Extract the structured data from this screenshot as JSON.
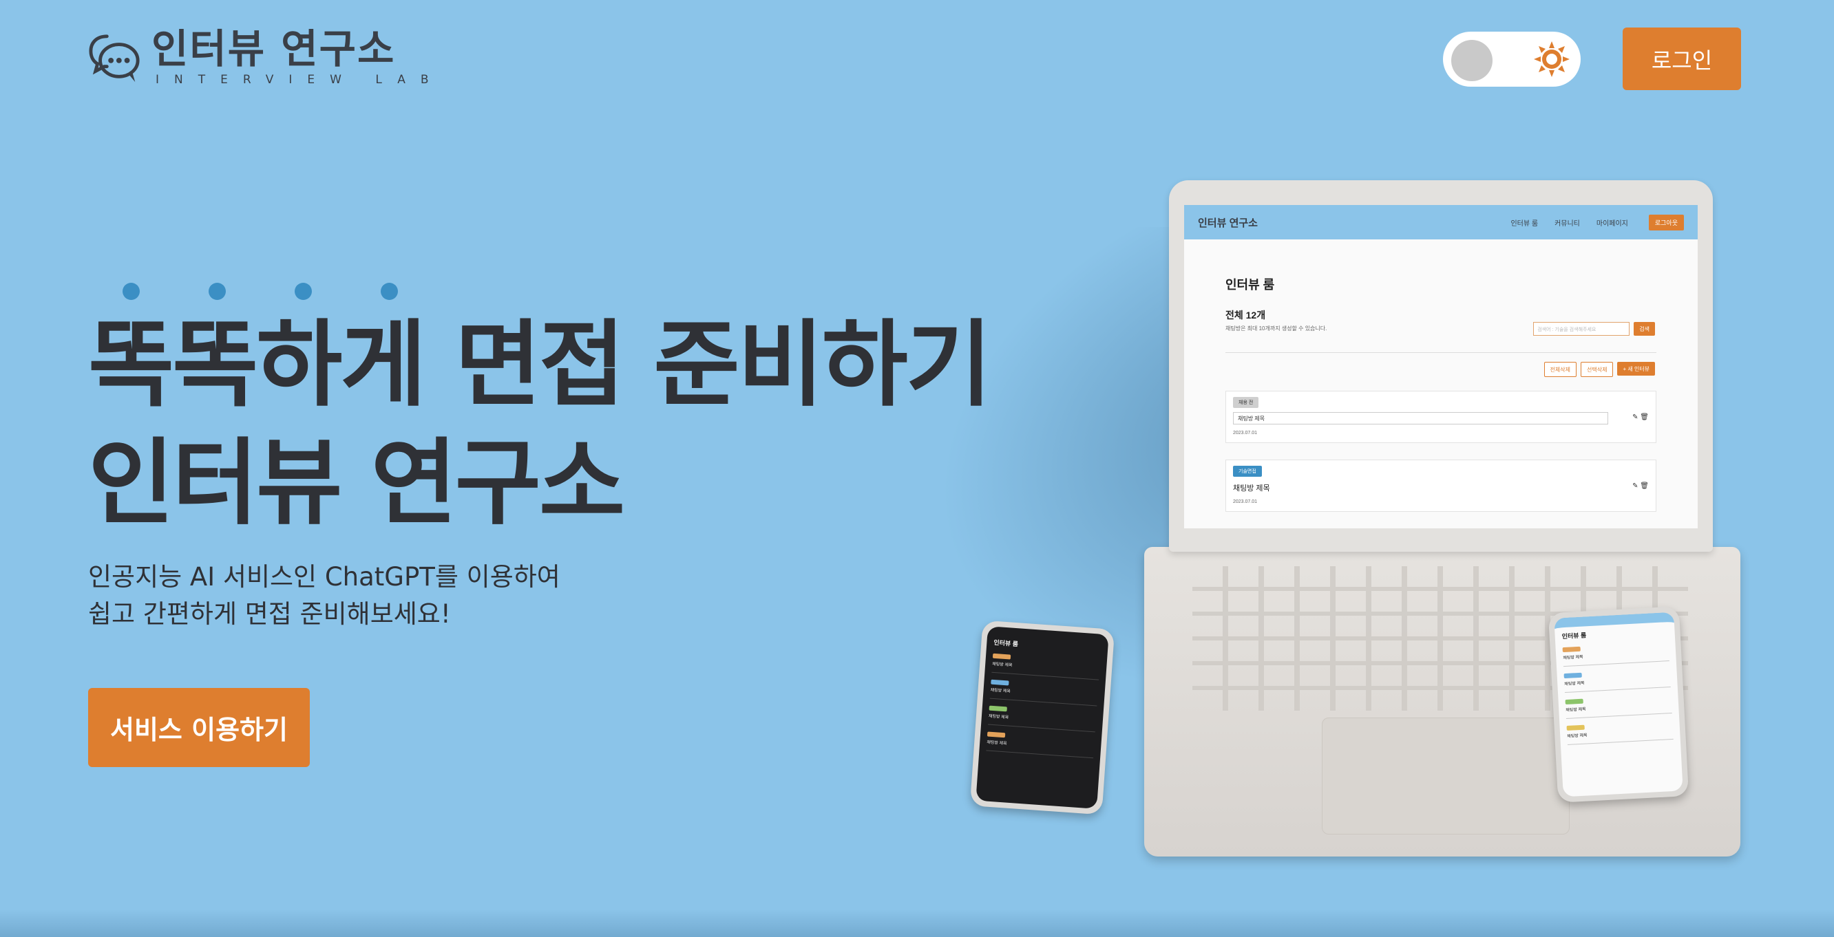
{
  "header": {
    "logo_title": "인터뷰 연구소",
    "logo_subtitle": "INTERVIEW LAB",
    "login_label": "로그인"
  },
  "theme_toggle": {
    "mode": "light",
    "icon": "sun-icon",
    "accent": "#de7e2f"
  },
  "hero": {
    "title_line1": "똑똑하게 면접 준비하기",
    "title_line2": "인터뷰 연구소",
    "desc_line1": "인공지능 AI 서비스인 ChatGPT를 이용하여",
    "desc_line2": "쉽고 간편하게 면접 준비해보세요!",
    "cta_label": "서비스 이용하기"
  },
  "mockup": {
    "nav_logo": "인터뷰 연구소",
    "nav_items": [
      "인터뷰 룸",
      "커뮤니티",
      "마이페이지"
    ],
    "nav_login": "로그아웃",
    "room_title": "인터뷰 룸",
    "count_label": "전체 12개",
    "count_note": "채팅방은 최대 10개까지 생성할 수 있습니다.",
    "search_placeholder": "검색어 : 기술을 검색해주세요",
    "search_button": "검색",
    "delete_all": "전체삭제",
    "delete_selected": "선택삭제",
    "new_interview": "+ 새 인터뷰",
    "cards": [
      {
        "tag": "채용 전",
        "title": "채팅방 제목",
        "date": "2023.07.01",
        "tag_color": "#cfcfcf"
      },
      {
        "tag": "기술면접",
        "title": "채팅방 제목",
        "date": "2023.07.01",
        "tag_color": "#3b8fc4"
      }
    ]
  },
  "colors": {
    "background": "#8bc4e9",
    "accent": "#de7e2f",
    "dot": "#3b8fc4",
    "text": "#2f3136"
  }
}
